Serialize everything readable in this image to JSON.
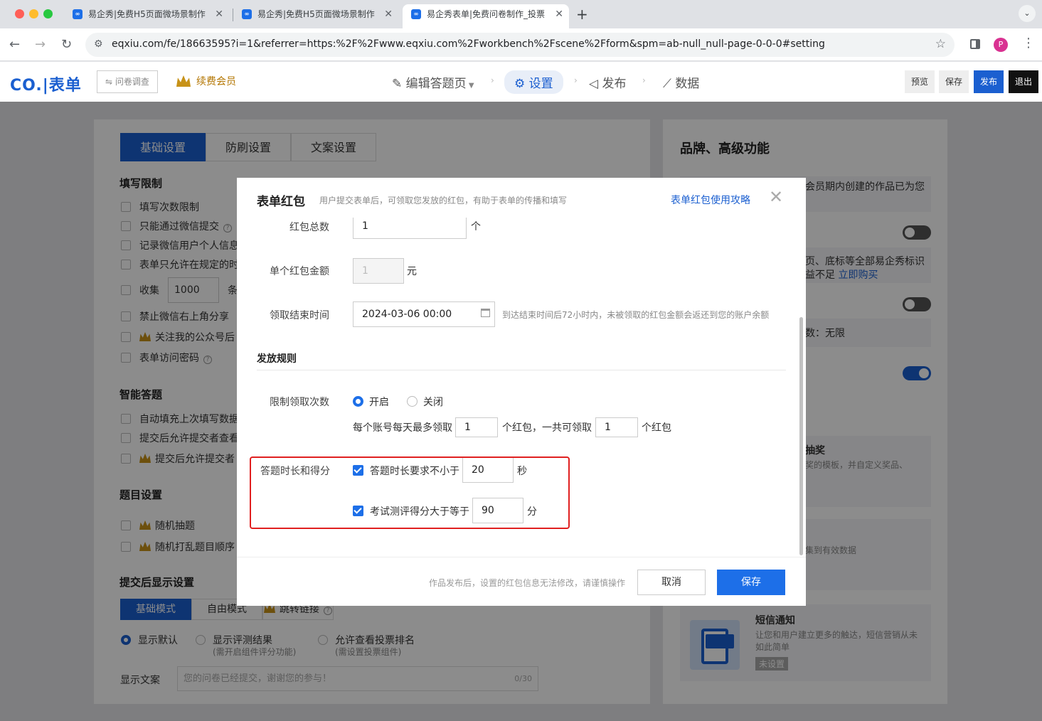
{
  "browser": {
    "tabs": [
      {
        "title": "易企秀|免费H5页面微场景制作"
      },
      {
        "title": "易企秀|免费H5页面微场景制作"
      },
      {
        "title": "易企秀表单|免费问卷制作_投票"
      }
    ],
    "url": "eqxiu.com/fe/18663595?i=1&referrer=https:%2F%2Fwww.eqxiu.com%2Fworkbench%2Fscene%2Fform&spm=ab-null_null-page-0-0-0#setting",
    "profile_initial": "P"
  },
  "app": {
    "logo": "CO.|表单",
    "survey_tag": "问卷调查",
    "vip_label": "续费会员",
    "steps": [
      "编辑答题页",
      "设置",
      "发布",
      "数据"
    ],
    "buttons": {
      "preview": "预览",
      "save": "保存",
      "publish": "发布",
      "exit": "退出"
    }
  },
  "left": {
    "tabs": [
      "基础设置",
      "防刷设置",
      "文案设置"
    ],
    "fill_limit_title": "填写限制",
    "fill_items": [
      "填写次数限制",
      "只能通过微信提交",
      "记录微信用户个人信息",
      "表单只允许在规定的时"
    ],
    "collect_prefix": "收集",
    "collect_value": "1000",
    "collect_suffix": "条",
    "more_items": [
      "禁止微信右上角分享",
      "关注我的公众号后",
      "表单访问密码"
    ],
    "smart_title": "智能答题",
    "smart_items": [
      "自动填充上次填写数据",
      "提交后允许提交者查看",
      "提交后允许提交者"
    ],
    "question_title": "题目设置",
    "question_items": [
      "随机抽题",
      "随机打乱题目顺序"
    ],
    "after_title": "提交后显示设置",
    "mode_tabs": [
      "基础模式",
      "自由模式",
      "跳转链接"
    ],
    "display_options": [
      {
        "label": "显示默认",
        "sub": ""
      },
      {
        "label": "显示评测结果",
        "sub": "(需开启组件评分功能)"
      },
      {
        "label": "允许查看投票排名",
        "sub": "(需设置投票组件)"
      }
    ],
    "copy_label": "显示文案",
    "copy_placeholder": "您的问卷已经提交，谢谢您的参与！",
    "copy_count": "0/30"
  },
  "right": {
    "title": "品牌、高级功能",
    "card1_text": "会员期内创建的作品已为您",
    "card2_line1": "页、底标等全部易企秀标识",
    "card2_line2": "益不足",
    "card2_link": "立即购买",
    "card3_text": "数：无限",
    "lottery_title": "抽奖",
    "lottery_desc": "奖的模板，并自定义奖品、",
    "collect_desc": "集到有效数据",
    "sms_title": "短信通知",
    "sms_desc1": "让您和用户建立更多的触达，短信营销从未",
    "sms_desc2": "如此简单",
    "sms_status": "未设置",
    "toggles": [
      false,
      false,
      true
    ]
  },
  "modal": {
    "title": "表单红包",
    "subtitle": "用户提交表单后，可领取您发放的红包，有助于表单的传播和填写",
    "guide_link": "表单红包使用攻略",
    "total_label": "红包总数",
    "total_value": "1",
    "total_unit": "个",
    "amount_label": "单个红包金额",
    "amount_value": "1",
    "amount_unit": "元",
    "end_label": "领取结束时间",
    "end_value": "2024-03-06 00:00",
    "end_hint": "到达结束时间后72小时内，未被领取的红包金额会返还到您的账户余额",
    "rules_title": "发放规则",
    "limit_label": "限制领取次数",
    "limit_on": "开启",
    "limit_off": "关闭",
    "daily_prefix": "每个账号每天最多领取",
    "daily_value": "1",
    "daily_mid": "个红包，一共可领取",
    "total_limit_value": "1",
    "daily_suffix": "个红包",
    "score_label": "答题时长和得分",
    "duration_text": "答题时长要求不小于",
    "duration_value": "20",
    "duration_unit": "秒",
    "score_text": "考试测评得分大于等于",
    "score_value": "90",
    "score_unit": "分",
    "footer_hint": "作品发布后，设置的红包信息无法修改，请谨慎操作",
    "cancel": "取消",
    "save": "保存"
  },
  "colors": {
    "accent": "#1d6fe8",
    "highlight": "#e02020",
    "brand": "#1b5fd0"
  }
}
